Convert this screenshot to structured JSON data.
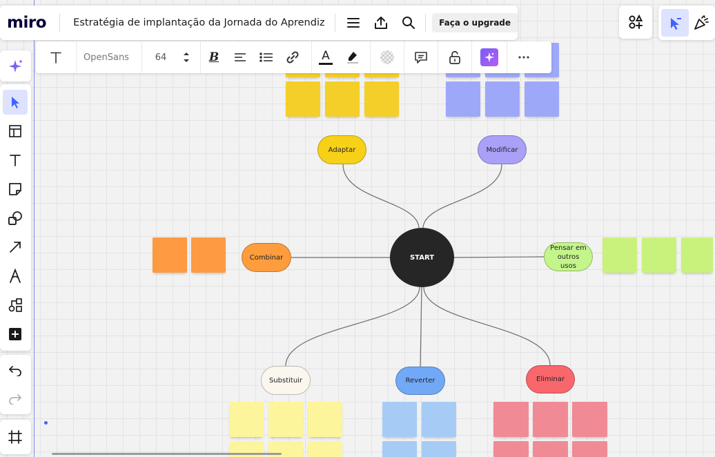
{
  "header": {
    "logo": "miro",
    "board_title": "Estratégia de implantação da Jornada do Aprendiz",
    "menu_icon": "hamburger-menu-icon",
    "export_icon": "upload-icon",
    "search_icon": "search-icon",
    "upgrade_label": "Faça o upgrade"
  },
  "top_right": {
    "apps_icon": "apps-plus-icon",
    "cursor_icon": "pointer-cursor-icon",
    "reactions_icon": "celebrate-icon"
  },
  "format_toolbar": {
    "text_tool_icon": "text-icon",
    "font_name": "OpenSans",
    "font_size": "64",
    "bold_icon": "bold-icon",
    "align_icon": "align-left-icon",
    "list_icon": "bullet-list-icon",
    "link_icon": "link-icon",
    "text_color_icon": "text-color-icon",
    "highlight_icon": "highlighter-icon",
    "fill_icon": "transparent-fill-icon",
    "comment_icon": "comment-icon",
    "lock_icon": "unlock-icon",
    "ai_icon": "ai-sparkle-icon",
    "more_icon": "more-horizontal-icon"
  },
  "left_toolbar": [
    {
      "name": "ai-assist-icon"
    },
    {
      "name": "select-cursor-icon",
      "active": true
    },
    {
      "name": "templates-icon"
    },
    {
      "name": "text-tool-icon"
    },
    {
      "name": "sticky-note-icon"
    },
    {
      "name": "shapes-icon"
    },
    {
      "name": "connection-line-icon"
    },
    {
      "name": "pen-icon"
    },
    {
      "name": "diagram-icon"
    },
    {
      "name": "add-more-icon"
    },
    {
      "name": "undo-icon"
    },
    {
      "name": "redo-icon"
    },
    {
      "name": "frame-icon"
    }
  ],
  "mindmap": {
    "center": "START",
    "branches": [
      {
        "label": "Adaptar",
        "color": "#f7d117"
      },
      {
        "label": "Modificar",
        "color": "#a9a0f8"
      },
      {
        "label": "Combinar",
        "color": "#fd9d3e"
      },
      {
        "label": "Pensar em outros usos",
        "color": "#c4f58a"
      },
      {
        "label": "Substituir",
        "color": "#fbf6ee"
      },
      {
        "label": "Reverter",
        "color": "#71a9f7"
      },
      {
        "label": "Eliminar",
        "color": "#f9676c"
      }
    ]
  },
  "sticky_colors": {
    "yellow": "#f5cf29",
    "violet": "#9ea8f9",
    "orange": "#fd9a42",
    "lime": "#c9f27d",
    "light_yellow": "#fdf59b",
    "light_blue": "#a6ccf5",
    "pink": "#f08b95"
  },
  "accent_color": "#4262ff"
}
